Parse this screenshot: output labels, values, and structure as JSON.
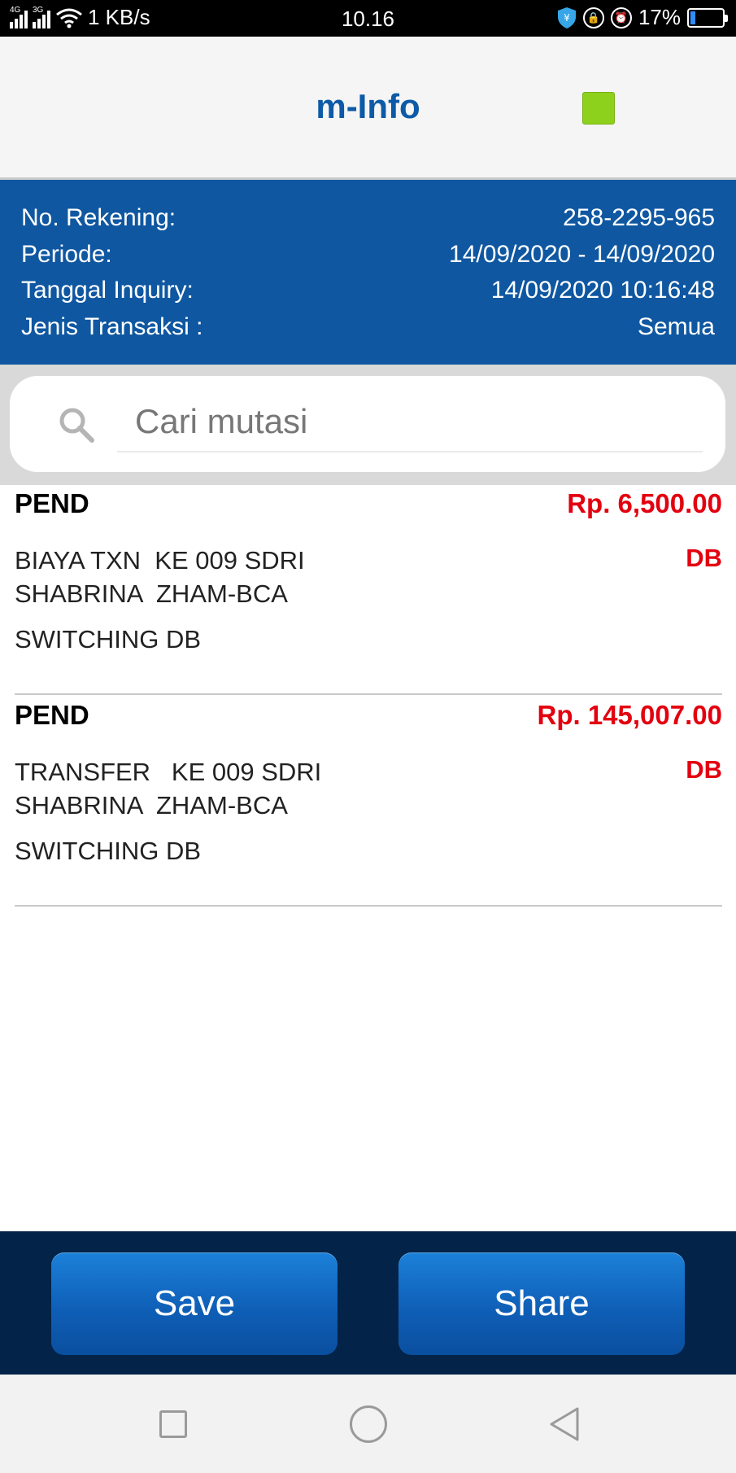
{
  "status_bar": {
    "net_4g": "4G",
    "net_3g": "3G",
    "speed": "1 KB/s",
    "time": "10.16",
    "battery_percent": "17%",
    "battery_level": 0.17
  },
  "header": {
    "title": "m-Info"
  },
  "info": {
    "account_label": "No. Rekening:",
    "account_value": "258-2295-965",
    "period_label": "Periode:",
    "period_value": "14/09/2020 - 14/09/2020",
    "inquiry_label": "Tanggal Inquiry:",
    "inquiry_value": "14/09/2020 10:16:48",
    "type_label": "Jenis Transaksi :",
    "type_value": "Semua"
  },
  "search": {
    "placeholder": "Cari mutasi"
  },
  "transactions": [
    {
      "status": "PEND",
      "amount": "Rp. 6,500.00",
      "description": "BIAYA TXN  KE 009 SDRI\nSHABRINA  ZHAM-BCA",
      "type": "DB",
      "channel": "SWITCHING DB"
    },
    {
      "status": "PEND",
      "amount": "Rp. 145,007.00",
      "description": "TRANSFER   KE 009 SDRI\nSHABRINA  ZHAM-BCA",
      "type": "DB",
      "channel": "SWITCHING DB"
    }
  ],
  "buttons": {
    "save_label": "Save",
    "share_label": "Share"
  },
  "colors": {
    "header_blue": "#0f57a1",
    "title_blue": "#0d5aa7",
    "amount_red": "#e3000f",
    "indicator_green": "#8ed11c",
    "footer_navy": "#032348"
  }
}
